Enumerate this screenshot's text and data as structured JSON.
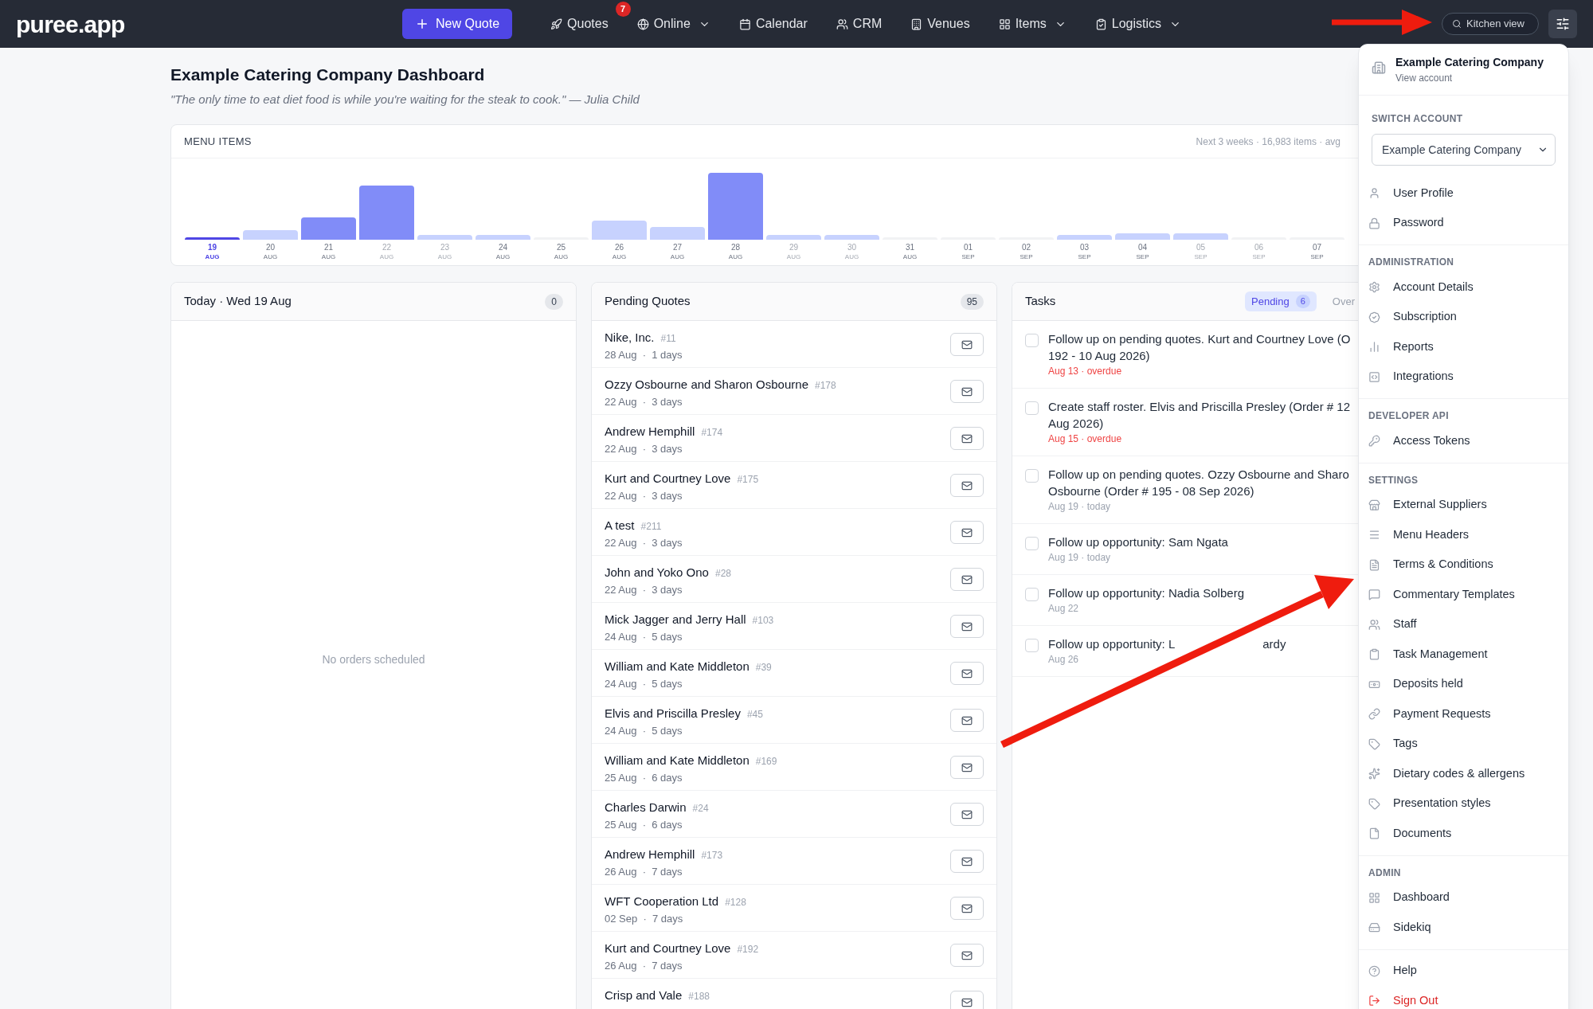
{
  "nav": {
    "logo": "puree.app",
    "new_quote": "New Quote",
    "items": [
      {
        "label": "Quotes",
        "badge": "7",
        "dropdown": false
      },
      {
        "label": "Online",
        "dropdown": true
      },
      {
        "label": "Calendar",
        "dropdown": false
      },
      {
        "label": "CRM",
        "dropdown": false
      },
      {
        "label": "Venues",
        "dropdown": false
      },
      {
        "label": "Items",
        "dropdown": true
      },
      {
        "label": "Logistics",
        "dropdown": true
      }
    ],
    "kitchen_button": {
      "label": "Kitchen view"
    }
  },
  "page": {
    "title": "Example Catering Company Dashboard",
    "quote": "\"The only time to eat diet food is while you're waiting for the steak to cook.\" — Julia Child"
  },
  "menu_items_chart": {
    "title": "MENU ITEMS",
    "summary": "Next 3 weeks · 16,983 items · avg",
    "days": [
      {
        "day": "19",
        "month": "AUG",
        "selected": true,
        "dimmed": false
      },
      {
        "day": "20",
        "month": "AUG",
        "selected": false,
        "dimmed": false
      },
      {
        "day": "21",
        "month": "AUG",
        "selected": false,
        "dimmed": false
      },
      {
        "day": "22",
        "month": "AUG",
        "selected": false,
        "dimmed": true
      },
      {
        "day": "23",
        "month": "AUG",
        "selected": false,
        "dimmed": true
      },
      {
        "day": "24",
        "month": "AUG",
        "selected": false,
        "dimmed": false
      },
      {
        "day": "25",
        "month": "AUG",
        "selected": false,
        "dimmed": false
      },
      {
        "day": "26",
        "month": "AUG",
        "selected": false,
        "dimmed": false
      },
      {
        "day": "27",
        "month": "AUG",
        "selected": false,
        "dimmed": false
      },
      {
        "day": "28",
        "month": "AUG",
        "selected": false,
        "dimmed": false
      },
      {
        "day": "29",
        "month": "AUG",
        "selected": false,
        "dimmed": true
      },
      {
        "day": "30",
        "month": "AUG",
        "selected": false,
        "dimmed": true
      },
      {
        "day": "31",
        "month": "AUG",
        "selected": false,
        "dimmed": false
      },
      {
        "day": "01",
        "month": "SEP",
        "selected": false,
        "dimmed": false
      },
      {
        "day": "02",
        "month": "SEP",
        "selected": false,
        "dimmed": false
      },
      {
        "day": "03",
        "month": "SEP",
        "selected": false,
        "dimmed": false
      },
      {
        "day": "04",
        "month": "SEP",
        "selected": false,
        "dimmed": false
      },
      {
        "day": "05",
        "month": "SEP",
        "selected": false,
        "dimmed": true
      },
      {
        "day": "06",
        "month": "SEP",
        "selected": false,
        "dimmed": true
      },
      {
        "day": "07",
        "month": "SEP",
        "selected": false,
        "dimmed": false
      }
    ]
  },
  "today": {
    "title": "Today · Wed 19 Aug",
    "count": "0",
    "empty": "No orders scheduled"
  },
  "pending_quotes": {
    "title": "Pending Quotes",
    "count": "95",
    "rows": [
      {
        "name": "Nike, Inc.",
        "number": "#11",
        "date": "28 Aug  ·  1 days"
      },
      {
        "name": "Ozzy Osbourne and Sharon Osbourne",
        "number": "#178",
        "date": "22 Aug  ·  3 days"
      },
      {
        "name": "Andrew Hemphill",
        "number": "#174",
        "date": "22 Aug  ·  3 days"
      },
      {
        "name": "Kurt and Courtney Love",
        "number": "#175",
        "date": "22 Aug  ·  3 days"
      },
      {
        "name": "A test",
        "number": "#211",
        "date": "22 Aug  ·  3 days"
      },
      {
        "name": "John and Yoko Ono",
        "number": "#28",
        "date": "22 Aug  ·  3 days"
      },
      {
        "name": "Mick Jagger and Jerry Hall",
        "number": "#103",
        "date": "24 Aug  ·  5 days"
      },
      {
        "name": "William and Kate Middleton",
        "number": "#39",
        "date": "24 Aug  ·  5 days"
      },
      {
        "name": "Elvis and Priscilla Presley",
        "number": "#45",
        "date": "24 Aug  ·  5 days"
      },
      {
        "name": "William and Kate Middleton",
        "number": "#169",
        "date": "25 Aug  ·  6 days"
      },
      {
        "name": "Charles Darwin",
        "number": "#24",
        "date": "25 Aug  ·  6 days"
      },
      {
        "name": "Andrew Hemphill",
        "number": "#173",
        "date": "26 Aug  ·  7 days"
      },
      {
        "name": "WFT Cooperation Ltd",
        "number": "#128",
        "date": "02 Sep  ·  7 days"
      },
      {
        "name": "Kurt and Courtney Love",
        "number": "#192",
        "date": "26 Aug  ·  7 days"
      },
      {
        "name": "Crisp and Vale",
        "number": "#188"
      }
    ]
  },
  "tasks": {
    "title": "Tasks",
    "tabs": [
      {
        "label": "Pending",
        "count": "6",
        "selected": true
      },
      {
        "label": "Over",
        "selected": false
      }
    ],
    "items": [
      {
        "lines": [
          "Follow up on pending quotes. Kurt and Courtney Love (O",
          "192 - 10 Aug 2026)"
        ],
        "due": "Aug 13 · overdue",
        "overdue": true,
        "checked": false
      },
      {
        "lines": [
          "Create staff roster. Elvis and Priscilla Presley (Order # 12",
          "Aug 2026)"
        ],
        "due": "Aug 15 · overdue",
        "overdue": true,
        "checked": false
      },
      {
        "lines": [
          "Follow up on pending quotes. Ozzy Osbourne and Sharo",
          "Osbourne (Order # 195 - 08 Sep 2026)"
        ],
        "due": "Aug 19 · today",
        "overdue": false,
        "checked": false
      },
      {
        "lines": [
          "Follow up opportunity: Sam Ngata"
        ],
        "due": "Aug 19 · today",
        "overdue": false,
        "checked": false
      },
      {
        "lines": [
          "Follow up opportunity: Nadia Solberg"
        ],
        "due": "Aug 22",
        "overdue": false,
        "checked": false
      },
      {
        "lines": [
          "Follow up opportunity: L"
        ],
        "line_end": "ardy",
        "due": "Aug 26",
        "overdue": false,
        "checked": false
      }
    ]
  },
  "account_menu": {
    "company": "Example Catering Company",
    "view_account": "View account",
    "switch_label": "SWITCH ACCOUNT",
    "account_select": "Example Catering Company",
    "sections": [
      {
        "items": [
          {
            "label": "User Profile",
            "kind": "link"
          },
          {
            "label": "Password",
            "kind": "link"
          }
        ]
      },
      {
        "heading": "ADMINISTRATION",
        "items": [
          {
            "label": "Account Details",
            "kind": "link"
          },
          {
            "label": "Subscription",
            "kind": "link"
          },
          {
            "label": "Reports",
            "kind": "link"
          },
          {
            "label": "Integrations",
            "kind": "link"
          }
        ]
      },
      {
        "heading": "DEVELOPER API",
        "items": [
          {
            "label": "Access Tokens",
            "kind": "link"
          }
        ]
      },
      {
        "heading": "SETTINGS",
        "items": [
          {
            "label": "External Suppliers",
            "kind": "link"
          },
          {
            "label": "Menu Headers",
            "kind": "link"
          },
          {
            "label": "Terms & Conditions",
            "kind": "link"
          },
          {
            "label": "Commentary Templates",
            "kind": "link"
          },
          {
            "label": "Staff",
            "kind": "link"
          },
          {
            "label": "Task Management",
            "kind": "link"
          },
          {
            "label": "Deposits held",
            "kind": "link"
          },
          {
            "label": "Payment Requests",
            "kind": "link"
          },
          {
            "label": "Tags",
            "kind": "link"
          },
          {
            "label": "Dietary codes & allergens",
            "kind": "link"
          },
          {
            "label": "Presentation styles",
            "kind": "link"
          },
          {
            "label": "Documents",
            "kind": "link"
          }
        ]
      },
      {
        "heading": "ADMIN",
        "items": [
          {
            "label": "Dashboard",
            "kind": "link"
          },
          {
            "label": "Sidekiq",
            "kind": "link"
          }
        ]
      },
      {
        "items": [
          {
            "label": "Help",
            "kind": "link"
          },
          {
            "label": "Sign Out",
            "kind": "danger"
          }
        ]
      }
    ]
  }
}
